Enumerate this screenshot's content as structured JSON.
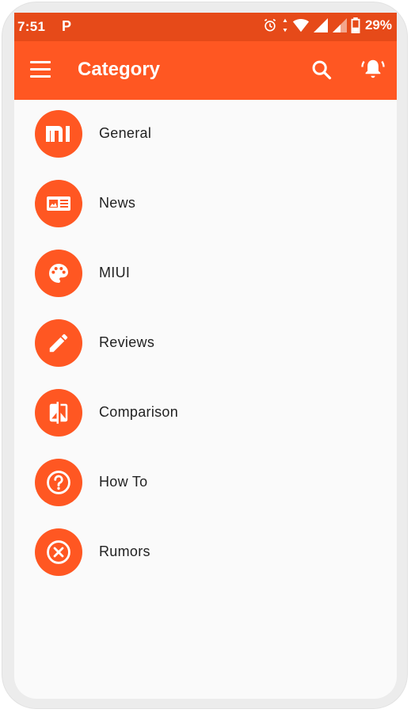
{
  "status_bar": {
    "time": "7:51",
    "notification_letter": "P",
    "battery_percent": "29%"
  },
  "app_bar": {
    "title": "Category",
    "icons": [
      "menu-icon",
      "search-icon",
      "bell-icon"
    ]
  },
  "categories": [
    {
      "label": "General",
      "icon": "mi-logo-icon"
    },
    {
      "label": "News",
      "icon": "news-card-icon"
    },
    {
      "label": "MIUI",
      "icon": "palette-icon"
    },
    {
      "label": "Reviews",
      "icon": "pencil-icon"
    },
    {
      "label": "Comparison",
      "icon": "compare-icon"
    },
    {
      "label": "How To",
      "icon": "help-circle-icon"
    },
    {
      "label": "Rumors",
      "icon": "cancel-circle-icon"
    }
  ],
  "colors": {
    "primary": "#ff5722",
    "primary_dark": "#e64a19",
    "background": "#fafafa",
    "text": "#222222"
  }
}
